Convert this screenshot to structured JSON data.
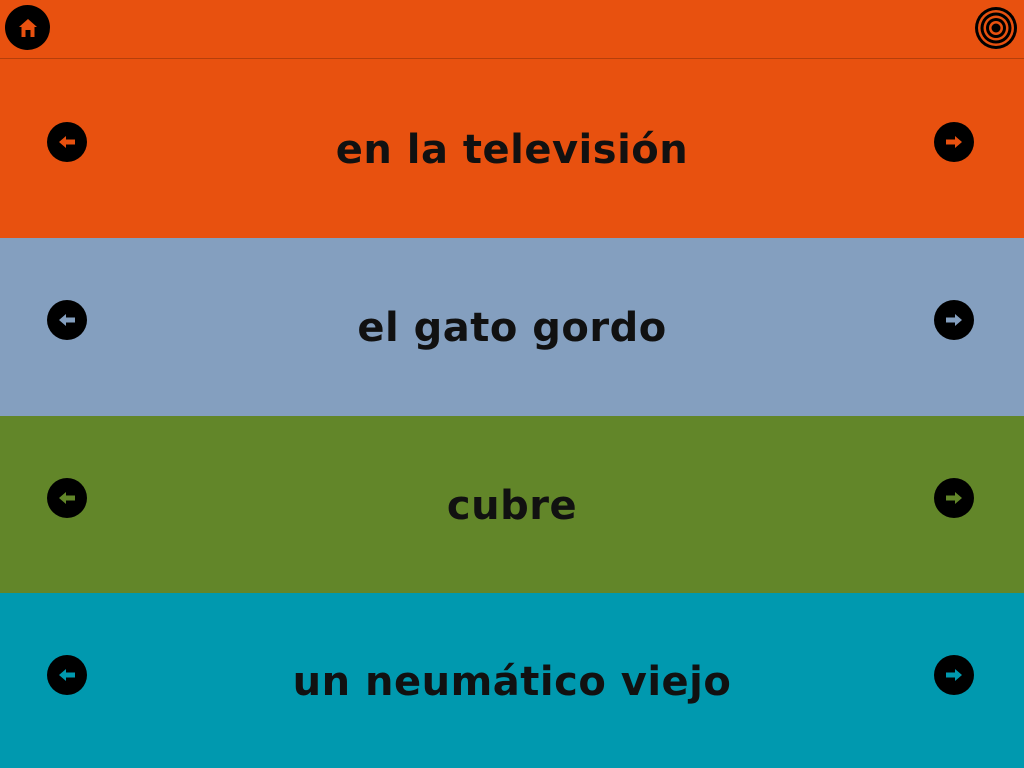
{
  "colors": {
    "row1": "#E8510F",
    "row2": "#849FBF",
    "row3": "#628629",
    "row4": "#0099AF",
    "topbar": "#E8510F",
    "icon_fg": "#E8510F"
  },
  "topbar": {
    "home_icon": "home-icon",
    "target_icon": "target-icon"
  },
  "rows": [
    {
      "text": "en la televisión",
      "prev_icon": "arrow-left-icon",
      "next_icon": "arrow-right-icon"
    },
    {
      "text": "el gato gordo",
      "prev_icon": "arrow-left-icon",
      "next_icon": "arrow-right-icon"
    },
    {
      "text": "cubre",
      "prev_icon": "arrow-left-icon",
      "next_icon": "arrow-right-icon"
    },
    {
      "text": "un neumático viejo",
      "prev_icon": "arrow-left-icon",
      "next_icon": "arrow-right-icon"
    }
  ]
}
